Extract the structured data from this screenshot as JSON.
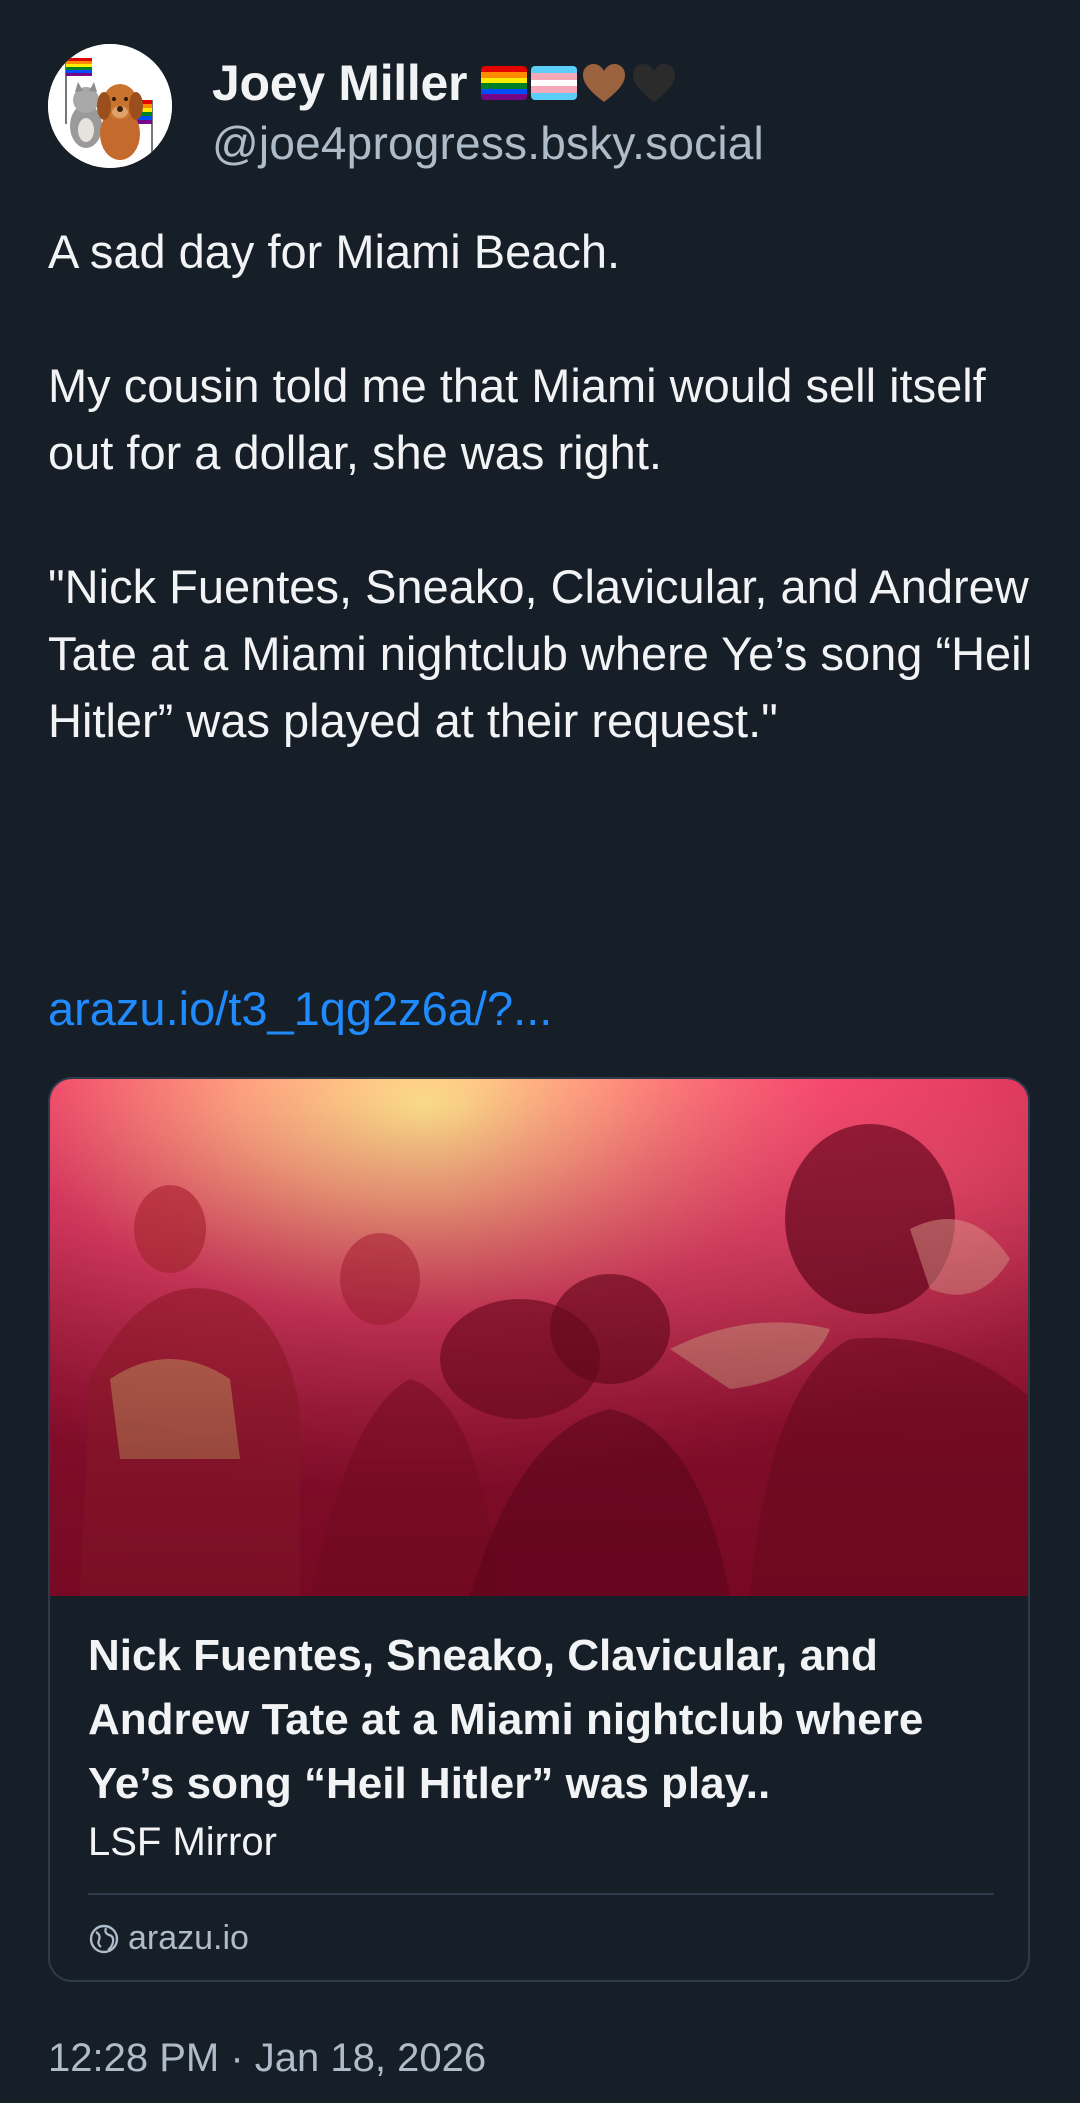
{
  "author": {
    "display_name": "Joey Miller",
    "handle": "@joe4progress.bsky.social",
    "avatar_icon": "avatar-cat-dog-pride-flags",
    "name_badges": [
      "rainbow-flag-icon",
      "trans-flag-icon",
      "brown-heart-icon",
      "black-heart-icon"
    ]
  },
  "post": {
    "text": "A sad day for Miami Beach.\n\nMy cousin told me that Miami would sell itself out for a dollar, she was right.\n\n\"Nick Fuentes, Sneako, Clavicular, and Andrew Tate at a Miami nightclub where Ye’s song “Heil Hitler” was played at their request.\"",
    "link_text": "arazu.io/t3_1qg2z6a/?..."
  },
  "link_card": {
    "title": "Nick Fuentes, Sneako, Clavicular, and Andrew Tate at a Miami nightclub where Ye’s song “Heil Hitler” was play..",
    "source": "LSF Mirror",
    "domain": "arazu.io",
    "domain_icon": "globe-icon"
  },
  "timestamp": "12:28 PM · Jan 18, 2026",
  "colors": {
    "background": "#161e27",
    "text": "#f1f3f5",
    "muted": "#aebbc9",
    "link": "#208bfe",
    "border": "#2c3a49"
  }
}
